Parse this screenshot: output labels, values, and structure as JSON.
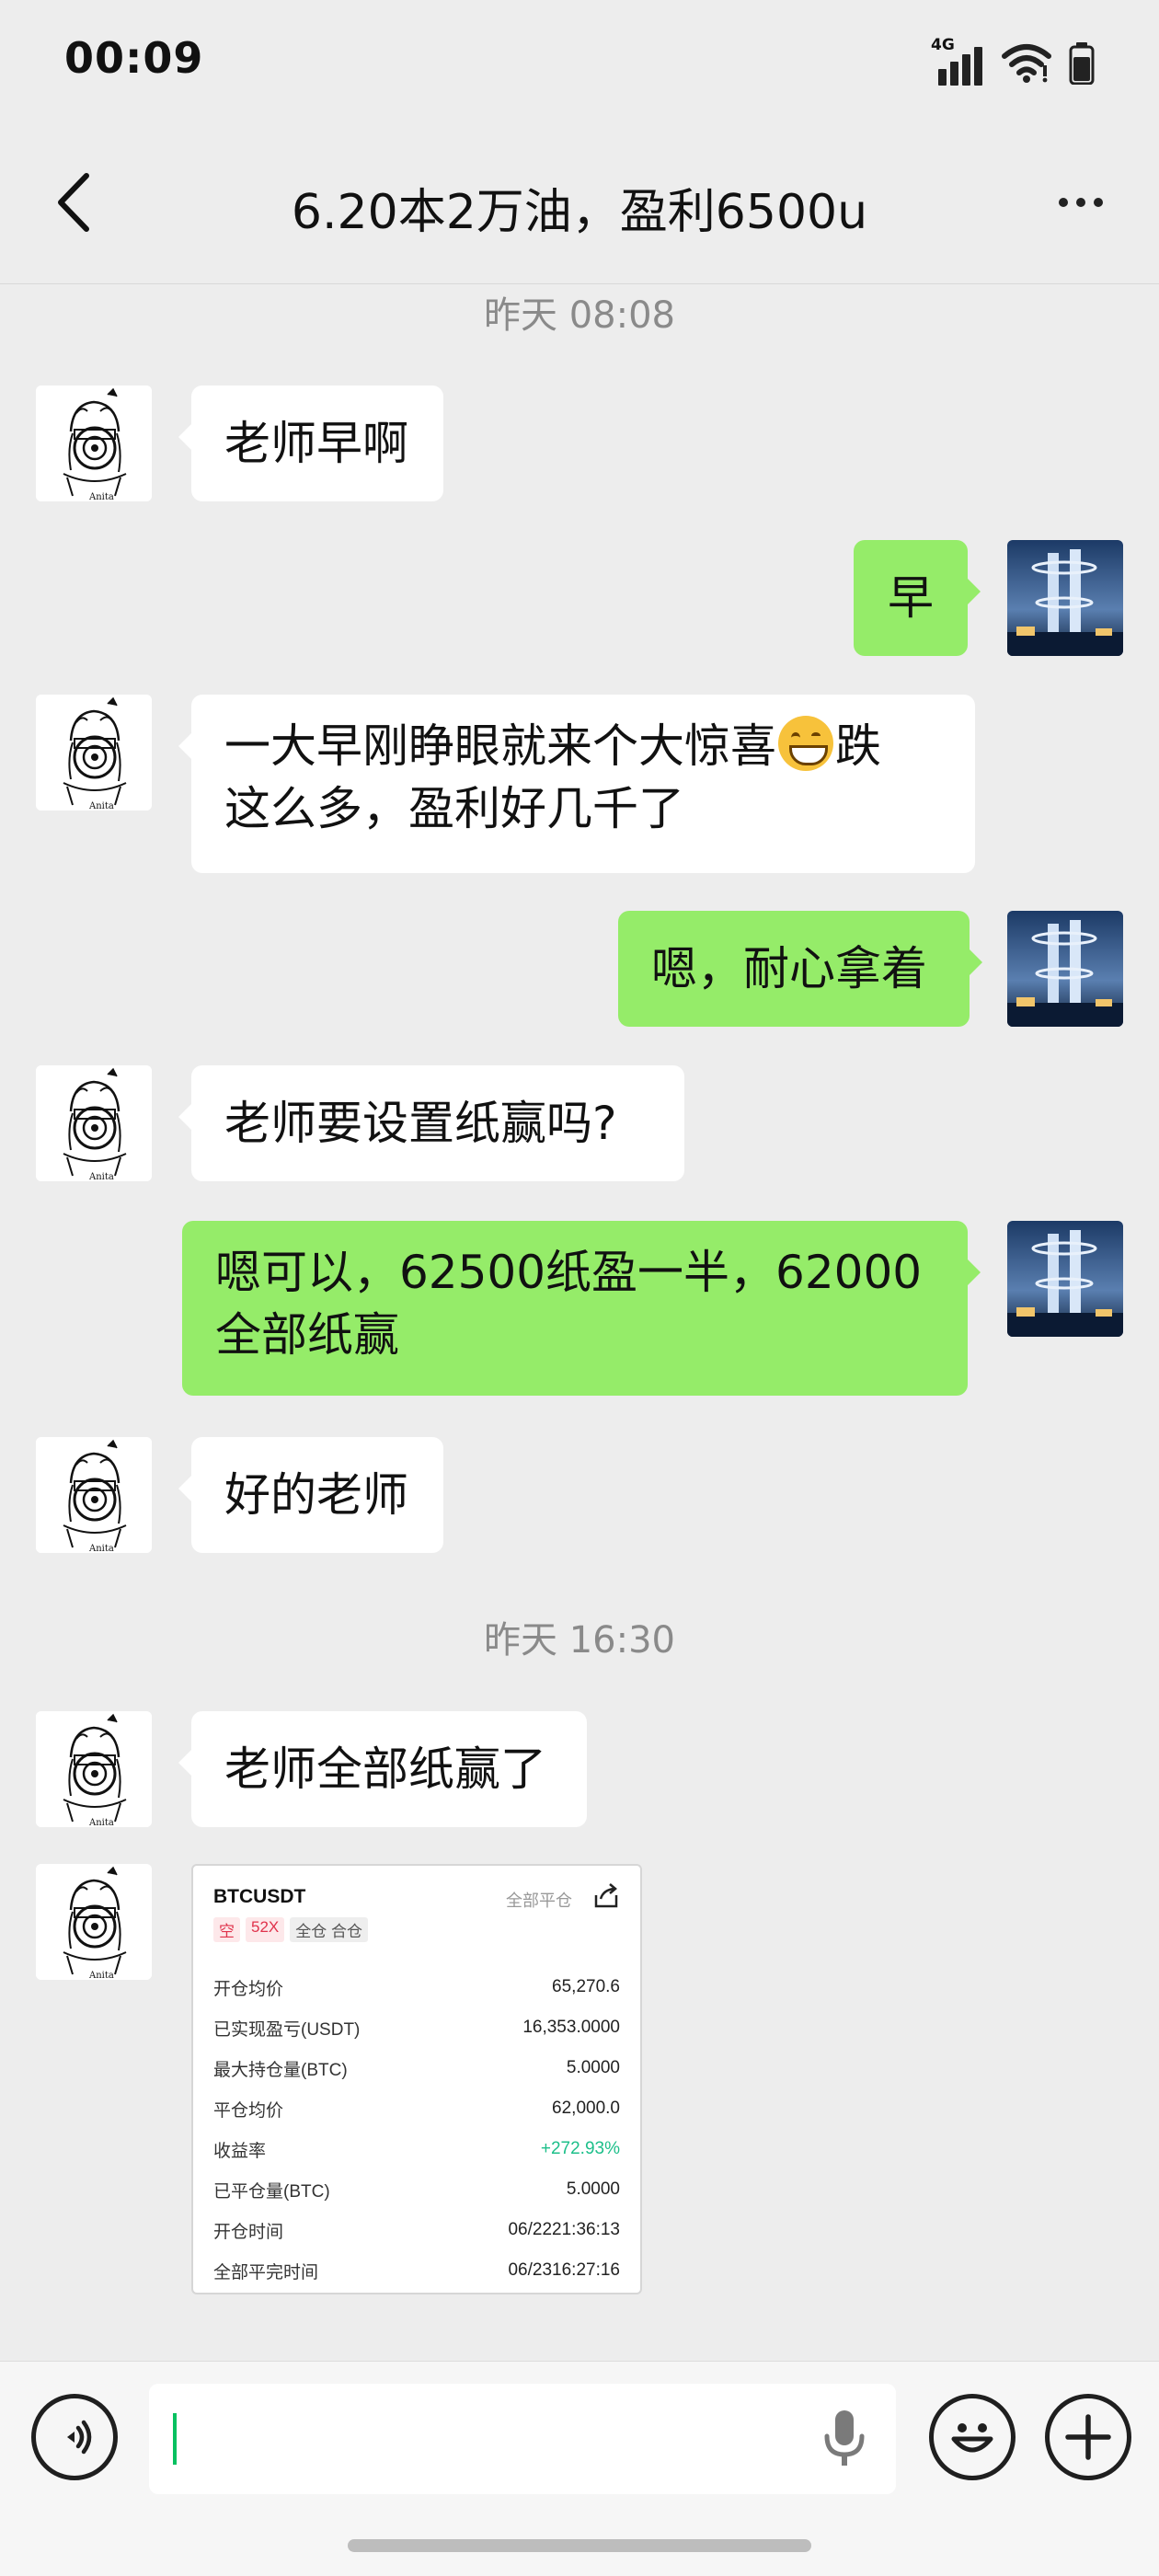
{
  "status_bar": {
    "time": "00:09",
    "network_label": "4G"
  },
  "header": {
    "title": "6.20本2万油，盈利6500u"
  },
  "timestamps": [
    "昨天 08:08",
    "昨天 16:30"
  ],
  "messages": [
    {
      "side": "left",
      "text": "老师早啊"
    },
    {
      "side": "right",
      "text": "早"
    },
    {
      "side": "left",
      "line1_before_emoji": "一大早刚睁眼就来个大惊喜",
      "emoji": "grinning-face-emoji",
      "line1_after_emoji": "跌",
      "line2": "这么多，盈利好几千了"
    },
    {
      "side": "right",
      "text": "嗯，耐心拿着"
    },
    {
      "side": "left",
      "text": "老师要设置纸赢吗?"
    },
    {
      "side": "right",
      "line1": "嗯可以，62500纸盈一半，62000",
      "line2": "全部纸赢"
    },
    {
      "side": "left",
      "text": "好的老师"
    },
    {
      "side": "left",
      "text": "老师全部纸赢了"
    }
  ],
  "trade_card": {
    "symbol": "BTCUSDT",
    "status": "全部平仓",
    "tags": [
      "空",
      "52X",
      "全仓 合仓"
    ],
    "rows": [
      {
        "label": "开仓均价",
        "value": "65,270.6"
      },
      {
        "label": "已实现盈亏(USDT)",
        "value": "16,353.0000"
      },
      {
        "label": "最大持仓量(BTC)",
        "value": "5.0000"
      },
      {
        "label": "平仓均价",
        "value": "62,000.0"
      },
      {
        "label": "收益率",
        "value": "+272.93%"
      },
      {
        "label": "已平仓量(BTC)",
        "value": "5.0000"
      },
      {
        "label": "开仓时间",
        "value": "06/2221:36:13"
      },
      {
        "label": "全部平完时间",
        "value": "06/2316:27:16"
      }
    ]
  },
  "input_bar": {
    "text": ""
  },
  "icons": {
    "back": "chevron-left-icon",
    "more": "more-horizontal-icon",
    "voice": "voice-icon",
    "mic": "microphone-icon",
    "emoji": "emoji-icon",
    "plus": "plus-icon"
  },
  "colors": {
    "outgoing_bubble": "#95ec69",
    "incoming_bubble": "#ffffff",
    "background": "#ededed",
    "positive": "#1dbf8a",
    "short_tag": "#e0334c"
  }
}
